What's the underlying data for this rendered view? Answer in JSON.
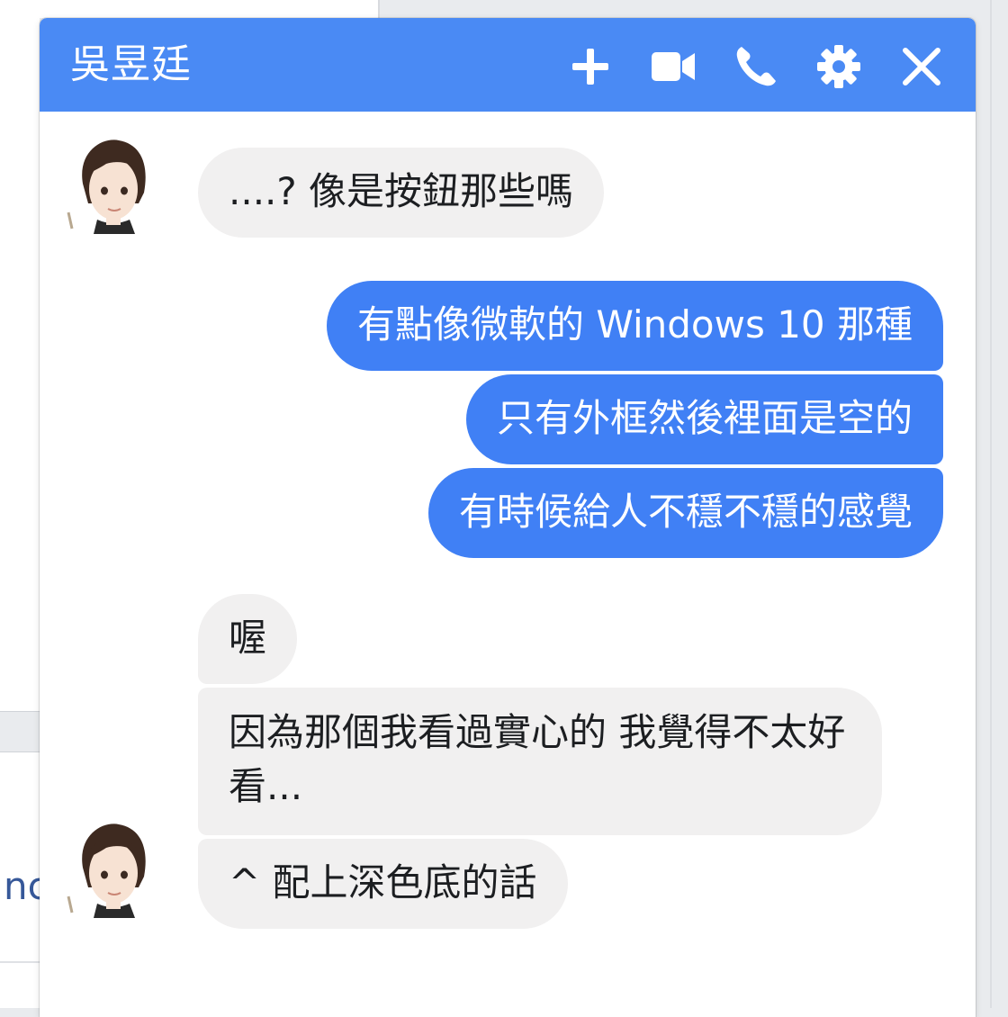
{
  "chat": {
    "title": "吳昱廷",
    "header_icons": [
      "plus-icon",
      "video-camera-icon",
      "phone-icon",
      "gear-icon",
      "close-icon"
    ],
    "accent_color": "#4a8af4",
    "outgoing_color": "#4080f5",
    "incoming_color": "#f1f0f0",
    "messages": [
      {
        "from": "them",
        "text": "....?  像是按鈕那些嗎"
      },
      {
        "from": "me",
        "text": "有點像微軟的 Windows 10 那種"
      },
      {
        "from": "me",
        "text": "只有外框然後裡面是空的"
      },
      {
        "from": "me",
        "text": "有時候給人不穩不穩的感覺"
      },
      {
        "from": "them",
        "text": "喔"
      },
      {
        "from": "them",
        "text": "因為那個我看過實心的  我覺得不太好看..."
      },
      {
        "from": "them",
        "text": "^ 配上深色底的話"
      }
    ]
  },
  "background": {
    "partial_text": "nc"
  }
}
